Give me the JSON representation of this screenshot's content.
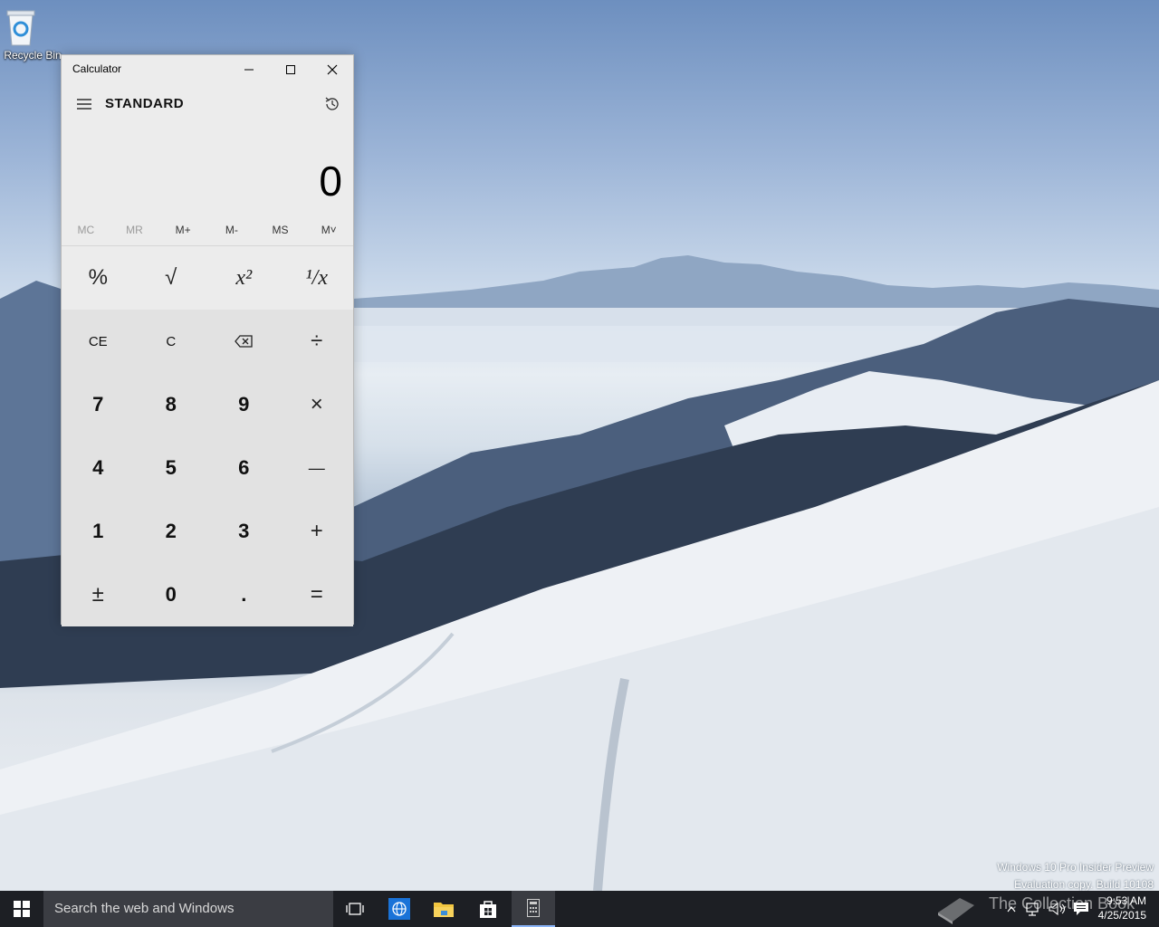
{
  "desktop": {
    "recycle_bin_label": "Recycle Bin",
    "watermark_line1": "Windows 10 Pro Insider Preview",
    "watermark_line2": "Evaluation copy. Build 10108"
  },
  "calculator": {
    "window_title": "Calculator",
    "mode": "STANDARD",
    "display_value": "0",
    "memory_buttons": [
      {
        "label": "MC",
        "enabled": false
      },
      {
        "label": "MR",
        "enabled": false
      },
      {
        "label": "M+",
        "enabled": true
      },
      {
        "label": "M-",
        "enabled": true
      },
      {
        "label": "MS",
        "enabled": true
      },
      {
        "label": "M˅",
        "enabled": true
      }
    ],
    "sci_keys": [
      "%",
      "√",
      "x²",
      "¹/x"
    ],
    "keys": {
      "ce": "CE",
      "c": "C",
      "divide": "÷",
      "seven": "7",
      "eight": "8",
      "nine": "9",
      "multiply": "×",
      "four": "4",
      "five": "5",
      "six": "6",
      "minus": "—",
      "one": "1",
      "two": "2",
      "three": "3",
      "plus": "+",
      "negate": "±",
      "zero": "0",
      "decimal": ".",
      "equals": "="
    }
  },
  "taskbar": {
    "search_placeholder": "Search the web and Windows",
    "brand_text": "The Collection Book",
    "time": "9:53 AM",
    "date": "4/25/2015"
  }
}
